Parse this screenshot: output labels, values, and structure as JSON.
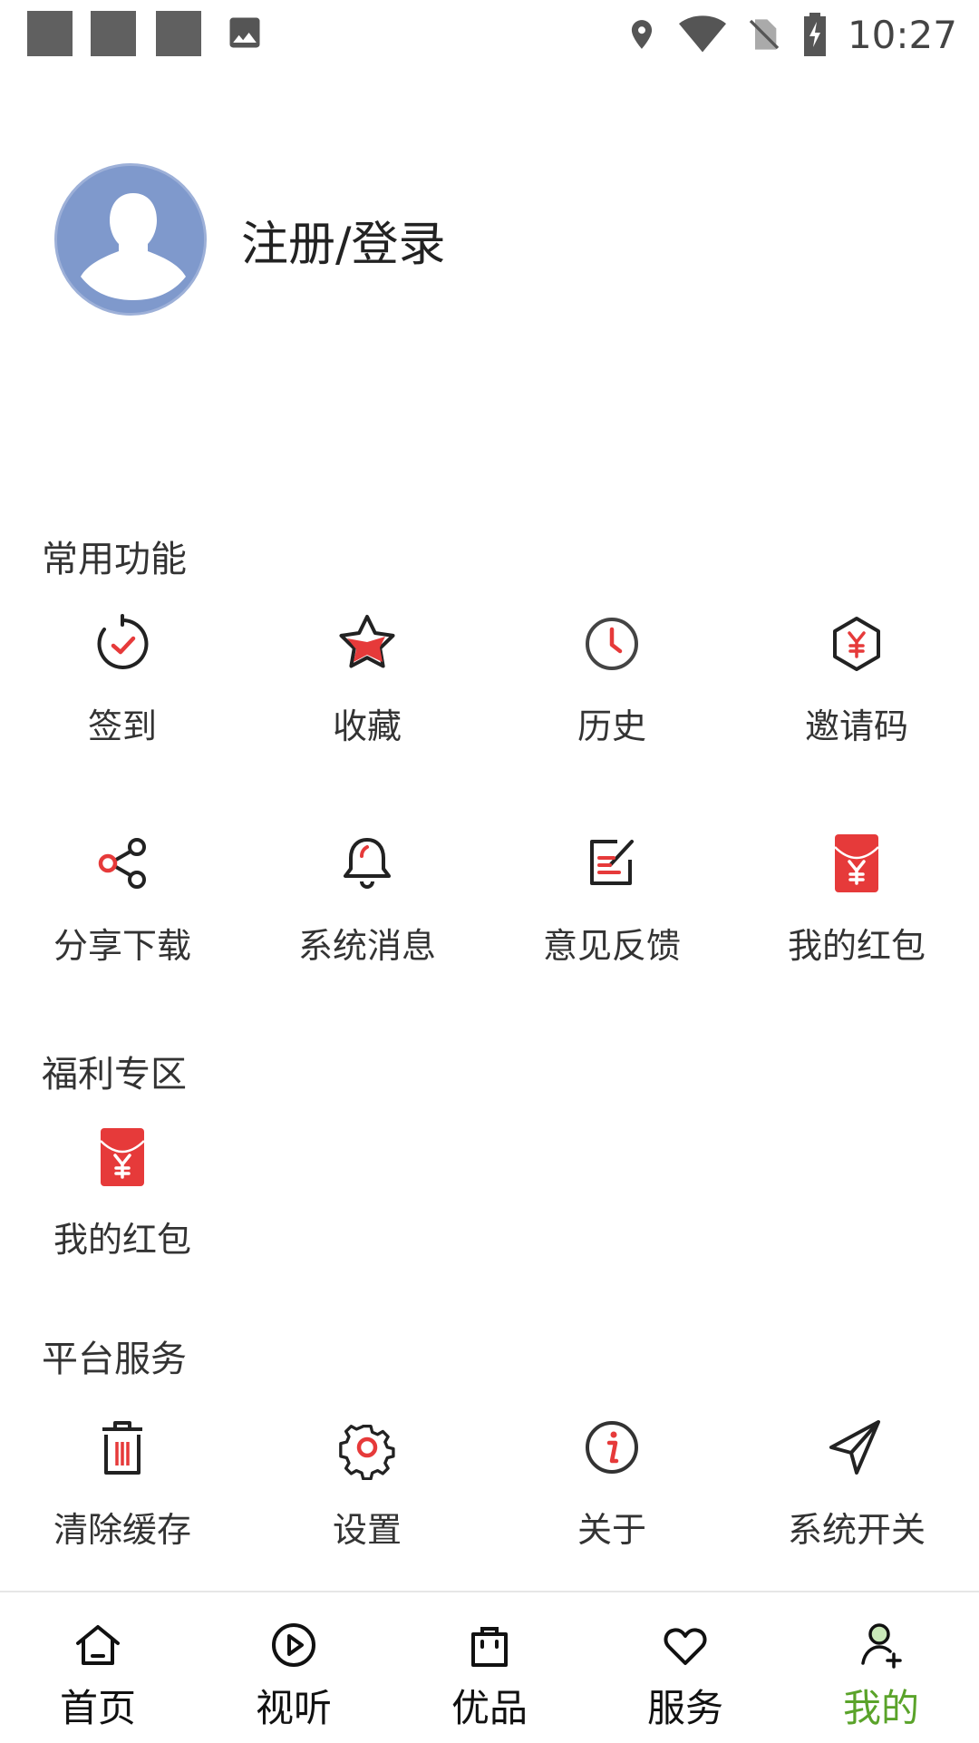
{
  "status_bar": {
    "time": "10:27",
    "left_icons": [
      "notification-square-icon",
      "notification-square-icon",
      "notification-square-icon",
      "image-icon"
    ],
    "right_icons": [
      "location-icon",
      "wifi-icon",
      "no-sim-icon",
      "battery-charging-icon"
    ]
  },
  "profile": {
    "login_label": "注册/登录",
    "avatar_icon": "user-avatar-icon"
  },
  "sections": {
    "common": {
      "title": "常用功能",
      "items": [
        {
          "label": "签到",
          "icon": "check-in-icon"
        },
        {
          "label": "收藏",
          "icon": "star-icon"
        },
        {
          "label": "历史",
          "icon": "clock-icon"
        },
        {
          "label": "邀请码",
          "icon": "yuan-hexagon-icon"
        },
        {
          "label": "分享下载",
          "icon": "share-icon"
        },
        {
          "label": "系统消息",
          "icon": "bell-icon"
        },
        {
          "label": "意见反馈",
          "icon": "edit-feedback-icon"
        },
        {
          "label": "我的红包",
          "icon": "red-envelope-icon"
        }
      ]
    },
    "welfare": {
      "title": "福利专区",
      "items": [
        {
          "label": "我的红包",
          "icon": "red-envelope-icon"
        }
      ]
    },
    "platform": {
      "title": "平台服务",
      "items": [
        {
          "label": "清除缓存",
          "icon": "trash-icon"
        },
        {
          "label": "设置",
          "icon": "gear-icon"
        },
        {
          "label": "关于",
          "icon": "info-icon"
        },
        {
          "label": "系统开关",
          "icon": "send-icon"
        }
      ]
    }
  },
  "bottom_nav": {
    "items": [
      {
        "label": "首页",
        "icon": "home-icon"
      },
      {
        "label": "视听",
        "icon": "play-circle-icon"
      },
      {
        "label": "优品",
        "icon": "shopping-bag-icon"
      },
      {
        "label": "服务",
        "icon": "heart-icon"
      },
      {
        "label": "我的",
        "icon": "user-add-icon"
      }
    ],
    "active_label": "我的",
    "active_color": "#5aa32a"
  },
  "colors": {
    "accent_red": "#e63a3a",
    "text": "#333333"
  }
}
